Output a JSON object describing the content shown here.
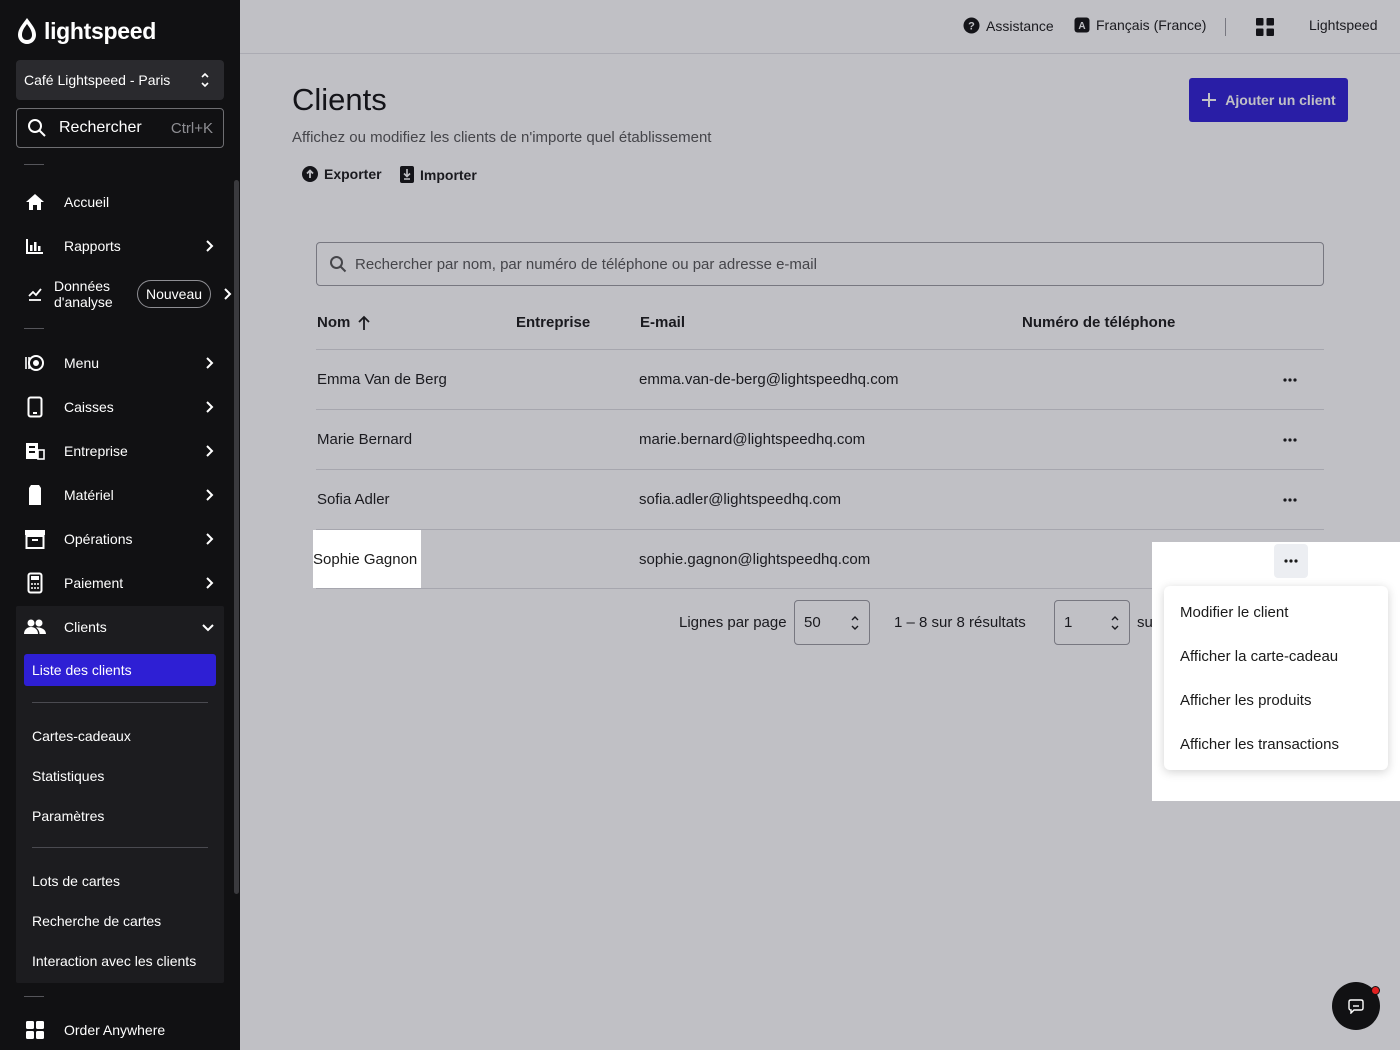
{
  "sidebar": {
    "brand": "lightspeed",
    "store": "Café Lightspeed - Paris",
    "search": {
      "label": "Rechercher",
      "shortcut": "Ctrl+K"
    },
    "nav": [
      {
        "label": "Accueil",
        "icon": "home-icon"
      },
      {
        "label": "Rapports",
        "icon": "bar-chart-icon"
      },
      {
        "label": "Données d'analyse",
        "icon": "analytics-icon",
        "badge": "Nouveau"
      },
      {
        "label": "Menu",
        "icon": "menu-book-icon"
      },
      {
        "label": "Caisses",
        "icon": "tablet-icon"
      },
      {
        "label": "Entreprise",
        "icon": "building-icon"
      },
      {
        "label": "Matériel",
        "icon": "device-icon"
      },
      {
        "label": "Opérations",
        "icon": "archive-icon"
      },
      {
        "label": "Paiement",
        "icon": "payment-terminal-icon"
      },
      {
        "label": "Clients",
        "icon": "people-icon"
      }
    ],
    "clients_sub": {
      "active": "Liste des clients",
      "group1": [
        "Cartes-cadeaux",
        "Statistiques",
        "Paramètres"
      ],
      "group2": [
        "Lots de cartes",
        "Recherche de cartes",
        "Interaction avec les clients"
      ]
    },
    "bottom": {
      "label": "Order Anywhere",
      "icon": "grid-icon"
    }
  },
  "topbar": {
    "help": "Assistance",
    "language": "Français (France)",
    "account": "Lightspeed"
  },
  "page": {
    "title": "Clients",
    "subtitle": "Affichez ou modifiez les clients de n'importe quel établissement",
    "add_button": "Ajouter un client",
    "export": "Exporter",
    "import": "Importer"
  },
  "table": {
    "search_placeholder": "Rechercher par nom, par numéro de téléphone ou par adresse e-mail",
    "columns": [
      "Nom",
      "Entreprise",
      "E-mail",
      "Numéro de téléphone"
    ],
    "rows": [
      {
        "name": "Emma Van de Berg",
        "company": "",
        "email": "emma.van-de-berg@lightspeedhq.com",
        "phone": ""
      },
      {
        "name": "Marie Bernard",
        "company": "",
        "email": "marie.bernard@lightspeedhq.com",
        "phone": ""
      },
      {
        "name": "Sofia Adler",
        "company": "",
        "email": "sofia.adler@lightspeedhq.com",
        "phone": ""
      },
      {
        "name": "Sophie Gagnon",
        "company": "",
        "email": "sophie.gagnon@lightspeedhq.com",
        "phone": ""
      }
    ]
  },
  "pagination": {
    "rows_label": "Lignes par page",
    "rows_value": "50",
    "range": "1 – 8 sur 8 résultats",
    "page_value": "1",
    "of_label": "sur"
  },
  "row_menu": {
    "items": [
      "Modifier le client",
      "Afficher la carte-cadeau",
      "Afficher les produits",
      "Afficher les transactions"
    ]
  },
  "colors": {
    "accent": "#2e1fd4",
    "sidebar_bg": "#111113",
    "notification": "#e02020"
  }
}
